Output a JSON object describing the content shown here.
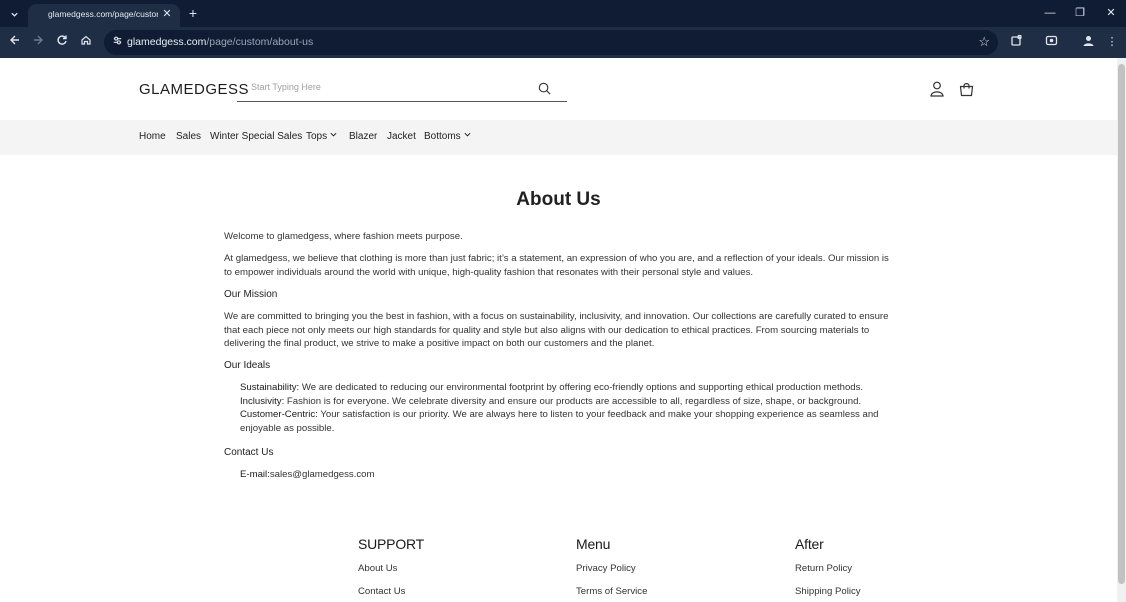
{
  "browser": {
    "tab_title": "glamedgess.com/page/custom/a",
    "url_domain": "glamedgess.com",
    "url_path": "/page/custom/about-us"
  },
  "site": {
    "logo": "GLAMEDGESS",
    "search_placeholder": "Start Typing Here",
    "nav": {
      "home": "Home",
      "sales": "Sales",
      "winter": "Winter Special Sales",
      "tops": "Tops",
      "blazer": "Blazer",
      "jacket": "Jacket",
      "bottoms": "Bottoms"
    }
  },
  "about": {
    "title": "About Us",
    "welcome": "Welcome to glamedgess, where fashion meets purpose.",
    "intro": "At glamedgess, we believe that clothing is more than just fabric; it’s a statement, an expression of who you are, and a reflection of your ideals. Our mission is to empower individuals around the world with unique, high-quality fashion that resonates with their personal style and values.",
    "mission_heading": "Our Mission",
    "mission_text": "We are committed to bringing you the best in fashion, with a focus on sustainability, inclusivity, and innovation. Our collections are carefully curated to ensure that each piece not only meets our high standards for quality and style but also aligns with our dedication to ethical practices. From sourcing materials to delivering the final product, we strive to make a positive impact on both our customers and the planet.",
    "ideals_heading": "Our Ideals",
    "ideals": [
      {
        "term": "Sustainability:",
        "text": " We are dedicated to reducing our environmental footprint by offering eco-friendly options and supporting ethical production methods."
      },
      {
        "term": "Inclusivity:",
        "text": " Fashion is for everyone. We celebrate diversity and ensure our products are accessible to all, regardless of size, shape, or background."
      },
      {
        "term": "Customer-Centric:",
        "text": " Your satisfaction is our priority. We are always here to listen to your feedback and make your shopping experience as seamless and enjoyable as possible."
      }
    ],
    "contact_heading": "Contact Us",
    "email_label": "E-mail:",
    "email": "sales@glamedgess.com"
  },
  "footer": {
    "support": {
      "heading": "SUPPORT",
      "links": [
        "About Us",
        "Contact Us"
      ]
    },
    "menu": {
      "heading": "Menu",
      "links": [
        "Privacy Policy",
        "Terms of Service"
      ]
    },
    "after": {
      "heading": "After",
      "links": [
        "Return Policy",
        "Shipping Policy"
      ]
    }
  }
}
